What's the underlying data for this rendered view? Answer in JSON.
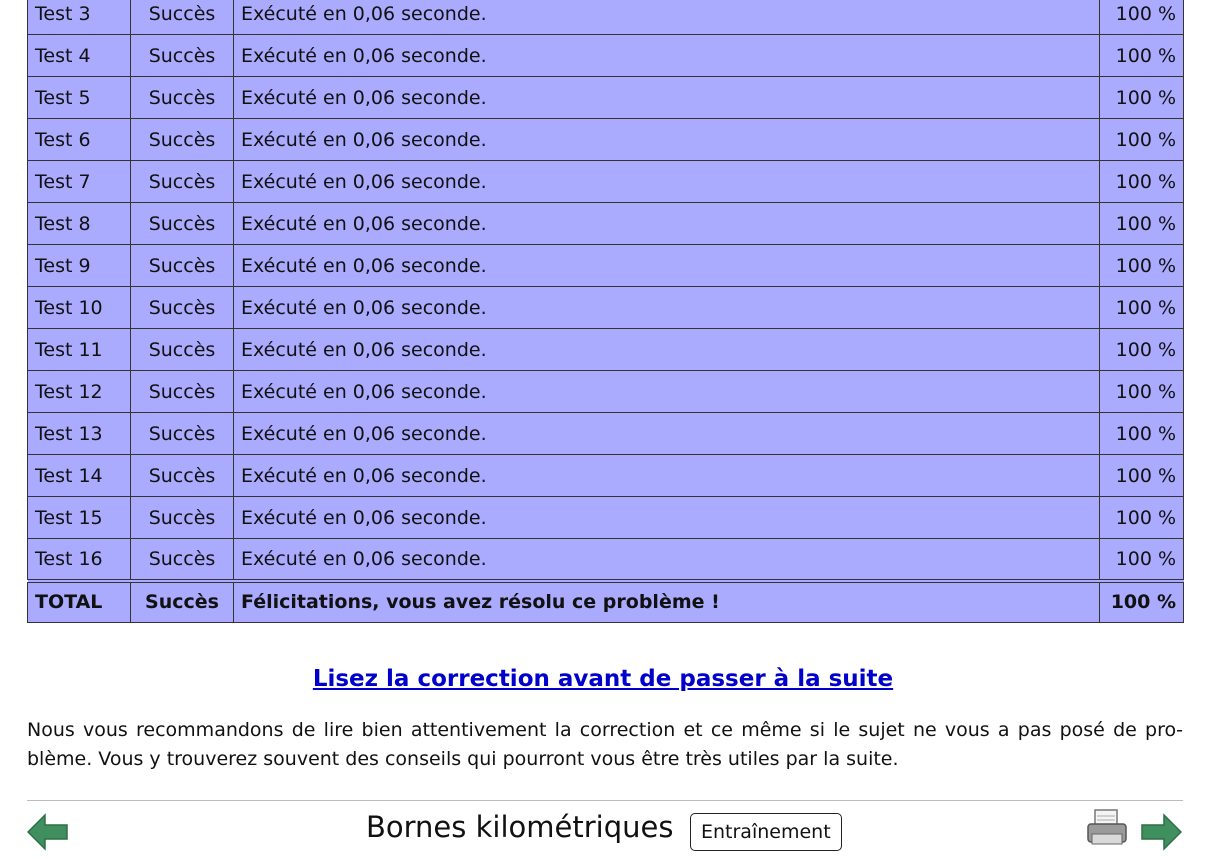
{
  "tests": [
    {
      "name": "Test 3",
      "status": "Succès",
      "message": "Exécuté en 0,06 seconde.",
      "score": "100 %"
    },
    {
      "name": "Test 4",
      "status": "Succès",
      "message": "Exécuté en 0,06 seconde.",
      "score": "100 %"
    },
    {
      "name": "Test 5",
      "status": "Succès",
      "message": "Exécuté en 0,06 seconde.",
      "score": "100 %"
    },
    {
      "name": "Test 6",
      "status": "Succès",
      "message": "Exécuté en 0,06 seconde.",
      "score": "100 %"
    },
    {
      "name": "Test 7",
      "status": "Succès",
      "message": "Exécuté en 0,06 seconde.",
      "score": "100 %"
    },
    {
      "name": "Test 8",
      "status": "Succès",
      "message": "Exécuté en 0,06 seconde.",
      "score": "100 %"
    },
    {
      "name": "Test 9",
      "status": "Succès",
      "message": "Exécuté en 0,06 seconde.",
      "score": "100 %"
    },
    {
      "name": "Test 10",
      "status": "Succès",
      "message": "Exécuté en 0,06 seconde.",
      "score": "100 %"
    },
    {
      "name": "Test 11",
      "status": "Succès",
      "message": "Exécuté en 0,06 seconde.",
      "score": "100 %"
    },
    {
      "name": "Test 12",
      "status": "Succès",
      "message": "Exécuté en 0,06 seconde.",
      "score": "100 %"
    },
    {
      "name": "Test 13",
      "status": "Succès",
      "message": "Exécuté en 0,06 seconde.",
      "score": "100 %"
    },
    {
      "name": "Test 14",
      "status": "Succès",
      "message": "Exécuté en 0,06 seconde.",
      "score": "100 %"
    },
    {
      "name": "Test 15",
      "status": "Succès",
      "message": "Exécuté en 0,06 seconde.",
      "score": "100 %"
    },
    {
      "name": "Test 16",
      "status": "Succès",
      "message": "Exécuté en 0,06 seconde.",
      "score": "100 %"
    }
  ],
  "total": {
    "name": "TOTAL",
    "status": "Succès",
    "message": "Félicitations, vous avez résolu ce problème !",
    "score": "100 %"
  },
  "correction_link": "Lisez la correction avant de passer à la suite",
  "advice": "Nous vous recommandons de lire bien attentivement la correction et ce même si le sujet ne vous a pas posé de pro­blème. Vous y trouverez souvent des conseils qui pourront vous être très utiles par la suite.",
  "footer": {
    "title": "Bornes kilométriques",
    "mode": "Entraînement",
    "icons": {
      "prev": "arrow-left-icon",
      "next": "arrow-right-icon",
      "print": "printer-icon"
    }
  },
  "colors": {
    "row_bg": "#aaaaff",
    "link": "#0000cc",
    "arrow": "#3f8f5f"
  }
}
